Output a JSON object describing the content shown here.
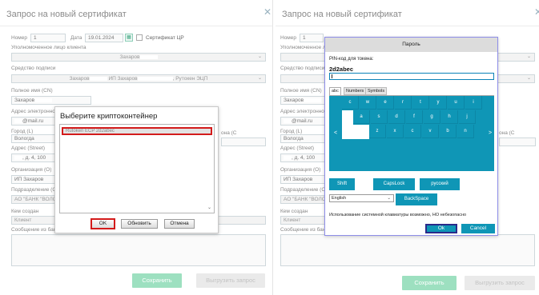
{
  "left": {
    "title": "Запрос на новый сертификат",
    "close_icon": "close-icon",
    "number_label": "Номер",
    "number_value": "1",
    "date_label": "Дата",
    "date_value": "19.01.2024",
    "ca_checkbox_label": "Сертификат ЦР",
    "client_label": "Уполномоченное лицо клиента",
    "client_value": "Захаров",
    "signing_label": "Средство подписи",
    "signing_value_1": "Захаров",
    "signing_value_2": "ИП Захаров",
    "signing_value_3": ", Рутокен ЭЦП",
    "cn_label": "Полное имя (CN)",
    "cn_value": "Захаров",
    "email_label": "Адрес электронно",
    "email_value": "@mail.ru",
    "city_label": "Город (L)",
    "city_value": "Вологда",
    "region_label_tail": "она (С",
    "street_label": "Адрес (Street)",
    "street_value": ", д. 4, 100",
    "org_label": "Организация (О)",
    "org_value": "ИП Захаров",
    "dept_label": "Подразделение (O",
    "dept_value": "АО \"БАНК \"ВОЛОГ",
    "created_label": "Кем создан",
    "created_value": "Клиент",
    "bank_msg_label": "Сообщение из бан",
    "save_label": "Сохранить",
    "export_label": "Выгрузить запрос"
  },
  "crypto": {
    "title": "Выберите криптоконтейнер",
    "item": "Rutoken ECP 2d2abec",
    "ok_label": "OK",
    "refresh_label": "Обновить",
    "cancel_label": "Отмена",
    "scroll_icon": "chevron-down-icon"
  },
  "right": {
    "title": "Запрос на новый сертификат",
    "number_label": "Номер",
    "number_value": "1",
    "client_label": "Уполномоченное лицо",
    "signing_label": "Средство подписи",
    "cn_label": "Полное имя (CN)",
    "cn_value": "Захаров",
    "email_label": "Адрес электронно",
    "email_value": "@mail.ru",
    "city_label": "Город (L)",
    "city_value": "Вологда",
    "region_label_tail": "она (С",
    "street_label": "Адрес (Street)",
    "street_value": ", д. 4, 100",
    "org_label": "Организация (О)",
    "org_value": "ИП Захаров",
    "dept_label": "Подразделение (O",
    "dept_value": "АО \"БАНК \"ВОЛОГ",
    "created_label": "Кем создан",
    "created_value": "Клиент",
    "bank_msg_label": "Сообщение из бан",
    "save_label": "Сохранить",
    "export_label": "Выгрузить запрос"
  },
  "pin": {
    "header": "Пароль",
    "label": "PIN-код для токена:",
    "token": "2d2abec",
    "tabs": [
      "abc",
      "Numbers",
      "Symbols"
    ],
    "keys_row1": [
      "c",
      "w",
      "e",
      "r",
      "t",
      "y",
      "u",
      "i"
    ],
    "keys_row2": [
      "a",
      "s",
      "d",
      "f",
      "g",
      "h",
      "j"
    ],
    "keys_row3": [
      "z",
      "x",
      "c",
      "v",
      "b",
      "n"
    ],
    "left_arrow": "<",
    "right_arrow": ">",
    "shift_label": "Shift",
    "capslock_label": "CapsLock",
    "lang_label": "русский",
    "lang_select": "English",
    "backspace_label": "BackSpace",
    "note": "Использование системной клавиатуры возможно, НО небезопасно",
    "ok_label": "Ok",
    "cancel_label": "Cancel"
  }
}
